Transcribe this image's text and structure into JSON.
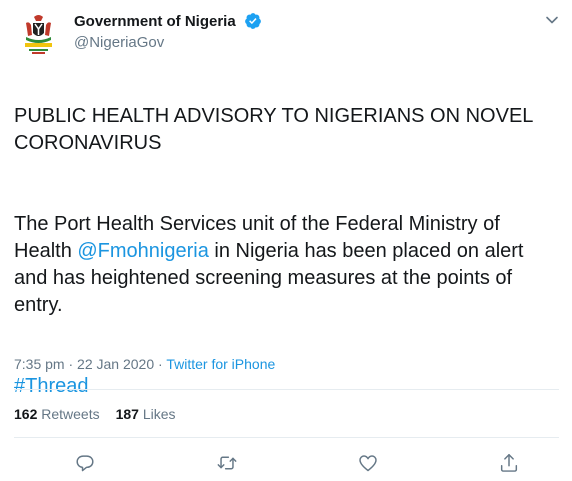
{
  "user": {
    "display_name": "Government of Nigeria",
    "handle": "@NigeriaGov",
    "verified": true,
    "avatar_caption": "FEDERAL GOVERNMENT OF NIGERIA"
  },
  "tweet": {
    "paragraph1": "PUBLIC HEALTH ADVISORY TO NIGERIANS ON NOVEL CORONAVIRUS",
    "paragraph2_before": "The Port Health Services unit of the Federal Ministry of Health ",
    "paragraph2_mention": "@Fmohnigeria",
    "paragraph2_after": " in Nigeria has been placed on alert and has heightened screening measures at the points of entry.",
    "hashtag": "#Thread"
  },
  "meta": {
    "time": "7:35 pm",
    "separator": " · ",
    "date": "22 Jan 2020",
    "separator2": " · ",
    "source": "Twitter for iPhone"
  },
  "stats": {
    "retweets_count": "162",
    "retweets_label": "Retweets",
    "likes_count": "187",
    "likes_label": "Likes"
  },
  "actions": [
    "reply-icon",
    "retweet-icon",
    "like-icon",
    "share-icon"
  ],
  "colors": {
    "link": "#1b95e0",
    "muted": "#657786",
    "text": "#14171a",
    "border": "#e6ecf0"
  }
}
